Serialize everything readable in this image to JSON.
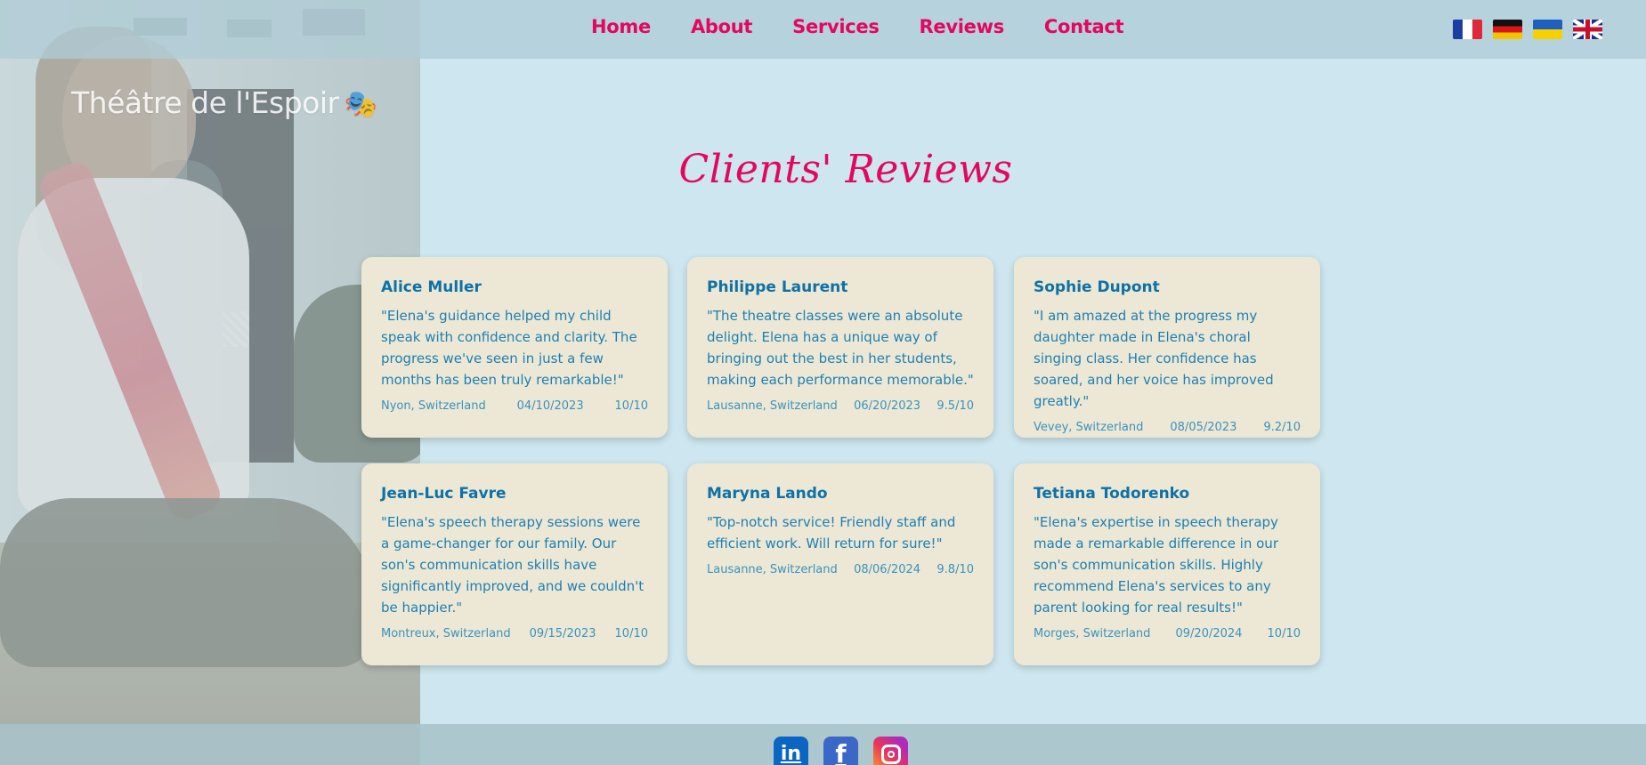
{
  "nav": {
    "items": [
      "Home",
      "About",
      "Services",
      "Reviews",
      "Contact"
    ]
  },
  "languages": [
    {
      "code": "fr",
      "icon": "france-flag-icon"
    },
    {
      "code": "de",
      "icon": "germany-flag-icon"
    },
    {
      "code": "ua",
      "icon": "ukraine-flag-icon"
    },
    {
      "code": "gb",
      "icon": "uk-flag-icon"
    }
  ],
  "logo": {
    "text": "Théâtre de l'Espoir",
    "emoji": "🎭"
  },
  "section": {
    "title": "Clients' Reviews"
  },
  "reviews": [
    {
      "name": "Alice Muller",
      "quote": "\"Elena's guidance helped my child speak with confidence and clarity. The progress we've seen in just a few months has been truly remarkable!\"",
      "location": "Nyon, Switzerland",
      "date": "04/10/2023",
      "rating": "10/10"
    },
    {
      "name": "Philippe Laurent",
      "quote": "\"The theatre classes were an absolute delight. Elena has a unique way of bringing out the best in her students, making each performance memorable.\"",
      "location": "Lausanne, Switzerland",
      "date": "06/20/2023",
      "rating": "9.5/10"
    },
    {
      "name": "Sophie Dupont",
      "quote": "\"I am amazed at the progress my daughter made in Elena's choral singing class. Her confidence has soared, and her voice has improved greatly.\"",
      "location": "Vevey, Switzerland",
      "date": "08/05/2023",
      "rating": "9.2/10"
    },
    {
      "name": "Jean-Luc Favre",
      "quote": "\"Elena's speech therapy sessions were a game-changer for our family. Our son's communication skills have significantly improved, and we couldn't be happier.\"",
      "location": "Montreux, Switzerland",
      "date": "09/15/2023",
      "rating": "10/10"
    },
    {
      "name": "Maryna Lando",
      "quote": "\"Top-notch service! Friendly staff and efficient work. Will return for sure!\"",
      "location": "Lausanne, Switzerland",
      "date": "08/06/2024",
      "rating": "9.8/10"
    },
    {
      "name": "Tetiana Todorenko",
      "quote": "\"Elena's expertise in speech therapy made a remarkable difference in our son's communication skills. Highly recommend Elena's services to any parent looking for real results!\"",
      "location": "Morges, Switzerland",
      "date": "09/20/2024",
      "rating": "10/10"
    }
  ],
  "social": [
    {
      "name": "linkedin",
      "glyph": "in",
      "icon": "linkedin-icon"
    },
    {
      "name": "facebook",
      "glyph": "f",
      "icon": "facebook-icon"
    },
    {
      "name": "instagram",
      "glyph": "",
      "icon": "instagram-icon"
    }
  ],
  "colors": {
    "accent": "#e3075f",
    "card_bg": "#ece8d5",
    "card_text": "#1d7fb4",
    "page_bg": "#cde6ef"
  }
}
